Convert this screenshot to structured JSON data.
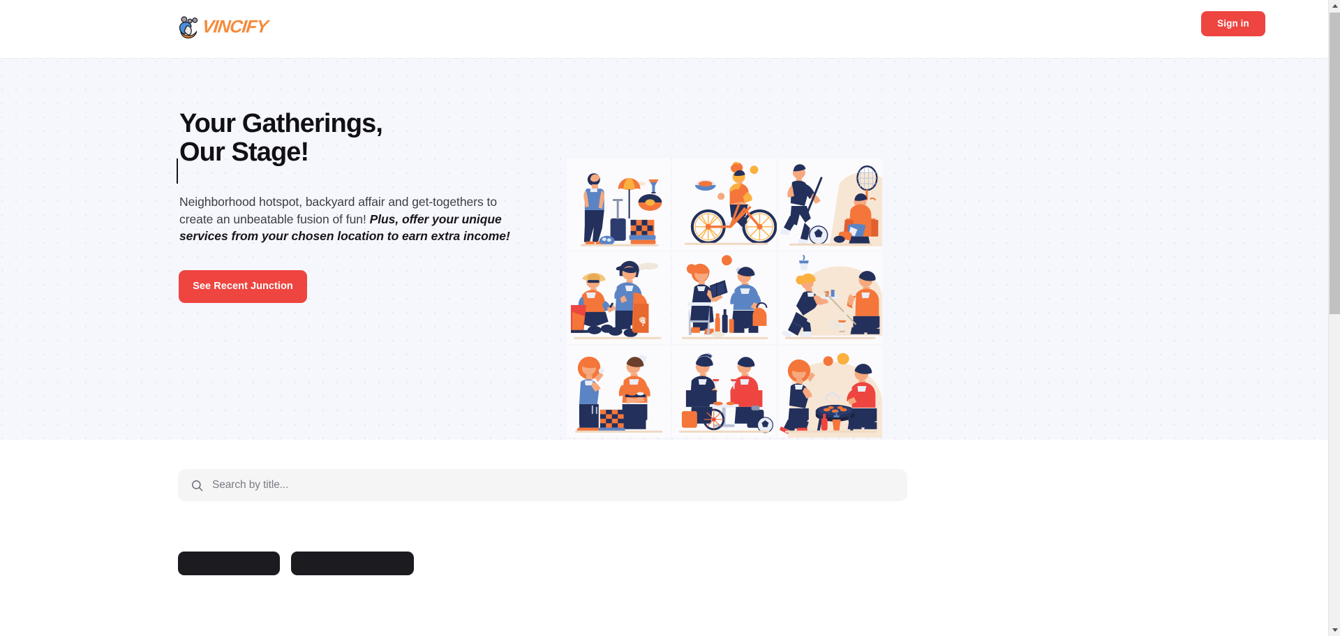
{
  "header": {
    "brand_name": "VINCIFY",
    "logo_icon": "people-group-logo-icon",
    "signin_label": "Sign in"
  },
  "hero": {
    "title_line1": "Your Gatherings,",
    "title_line2": "Our Stage!",
    "subtitle_normal": "Neighborhood hotspot, backyard affair and get-togethers to create an unbeatable fusion of fun! ",
    "subtitle_emphasis": "Plus, offer your unique services from your chosen location to earn extra income!",
    "cta_label": "See Recent Junction",
    "illustration_alt": "Collage of nine flat-style illustrations of people at gatherings",
    "tiles": [
      {
        "name": "traveler-with-suitcase-and-picnic"
      },
      {
        "name": "cyclist-with-food-items"
      },
      {
        "name": "runner-and-seated-person-with-racket"
      },
      {
        "name": "two-men-talking-in-armchairs"
      },
      {
        "name": "woman-reading-and-man-with-bag"
      },
      {
        "name": "woman-serving-and-man-relaxing"
      },
      {
        "name": "couple-with-chessboard-and-tray"
      },
      {
        "name": "couple-dining-at-table"
      },
      {
        "name": "woman-and-man-at-barbecue-grill"
      }
    ]
  },
  "search": {
    "icon": "search-icon",
    "placeholder": "Search by title...",
    "value": ""
  },
  "filters": {
    "chips": [
      {
        "label": ""
      },
      {
        "label": ""
      }
    ]
  },
  "colors": {
    "accent_red": "#ee4540",
    "hero_bg": "#f6f7fc",
    "dot": "#dfe1ee",
    "heading": "#111016",
    "body_text": "#3c3c47",
    "search_bg": "#f5f5f6",
    "illustration_orange": "#f4763a",
    "illustration_navy": "#23305b",
    "illustration_blue": "#5b84c4",
    "illustration_skin": "#f6a97f",
    "illustration_sand": "#f7e6d4"
  },
  "scrollbar": {
    "up_icon": "scroll-up-arrow-icon",
    "down_icon": "scroll-down-arrow-icon"
  }
}
